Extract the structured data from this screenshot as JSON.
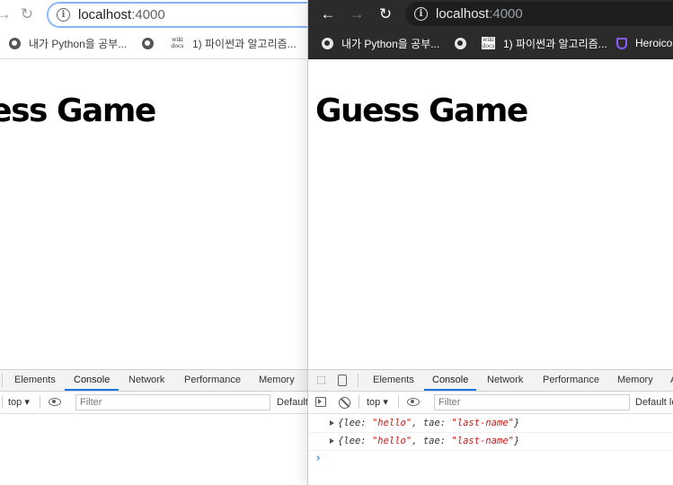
{
  "left_window": {
    "url_host": "localhost",
    "url_port": ":4000",
    "bookmarks": [
      "내가 Python을 공부...",
      "1) 파이썬과 알고리즘...",
      "wiki docs"
    ],
    "page_title": "Guess Game",
    "devtools": {
      "tabs": [
        "Elements",
        "Console",
        "Network",
        "Performance",
        "Memory"
      ],
      "active_tab": "Console",
      "context": "top ▾",
      "filter_placeholder": "Filter",
      "levels": "Default"
    }
  },
  "right_window": {
    "url_host": "localhost",
    "url_port": ":4000",
    "bookmarks": [
      "내가 Python을 공부...",
      "1) 파이썬과 알고리즘...",
      "Heroico",
      "wiki docs"
    ],
    "page_title": "Guess Game",
    "devtools": {
      "tabs": [
        "Elements",
        "Console",
        "Network",
        "Performance",
        "Memory",
        "A"
      ],
      "active_tab": "Console",
      "context": "top ▾",
      "filter_placeholder": "Filter",
      "levels": "Default le",
      "logs": [
        {
          "open": "{lee: ",
          "v1": "\"hello\"",
          "mid": ", tae: ",
          "v2": "\"last-name\"",
          "close": "}"
        },
        {
          "open": "{lee: ",
          "v1": "\"hello\"",
          "mid": ", tae: ",
          "v2": "\"last-name\"",
          "close": "}"
        }
      ],
      "prompt": "›"
    }
  },
  "colors": {
    "dark_toolbar": "#2b2b2b",
    "active_tab_underline": "#1a73e8",
    "console_string": "#c41a16",
    "heroicons_purple": "#8a5cf6"
  }
}
